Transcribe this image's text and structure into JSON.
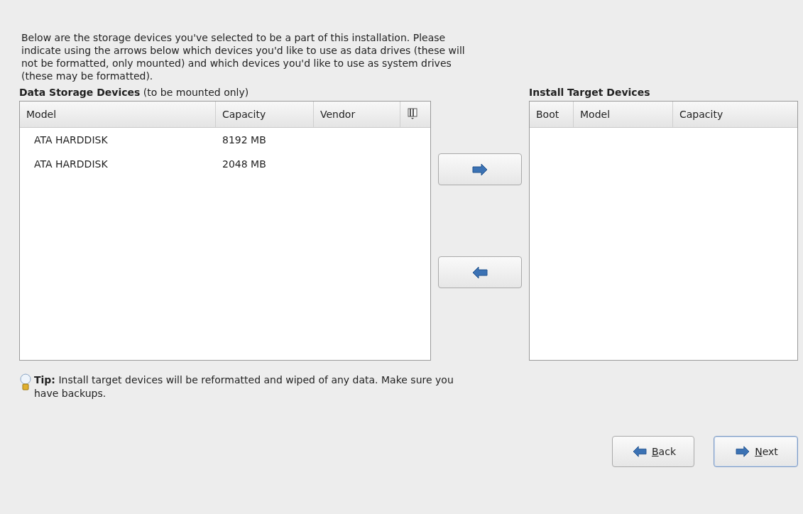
{
  "intro": "Below are the storage devices you've selected to be a part of this installation.  Please\nindicate using the arrows below which devices you'd like to use as data drives (these will\nnot be formatted, only mounted) and which devices you'd like to use as system drives\n(these may be formatted).",
  "data_storage": {
    "title": "Data Storage Devices",
    "subtitle": "(to be mounted only)",
    "columns": [
      "Model",
      "Capacity",
      "Vendor"
    ],
    "rows": [
      {
        "model": "ATA HARDDISK",
        "capacity": "8192 MB",
        "selected": false
      },
      {
        "model": "ATA HARDDISK",
        "capacity": "2048 MB",
        "selected": false
      }
    ]
  },
  "move_buttons": [
    {
      "kind": "right"
    },
    {
      "kind": "left"
    }
  ],
  "install_target": {
    "title": "Install Target Devices",
    "columns": [
      "Boot",
      "Model",
      "Capacity"
    ]
  },
  "tip": "**Tip:** Install target devices will be reformatted and wiped of any data.  Make sure you\nhave backups.",
  "buttons": [
    {
      "label": "Back",
      "kind": "left",
      "focused": false
    },
    {
      "label": "Next",
      "kind": "right",
      "focused": true
    }
  ]
}
